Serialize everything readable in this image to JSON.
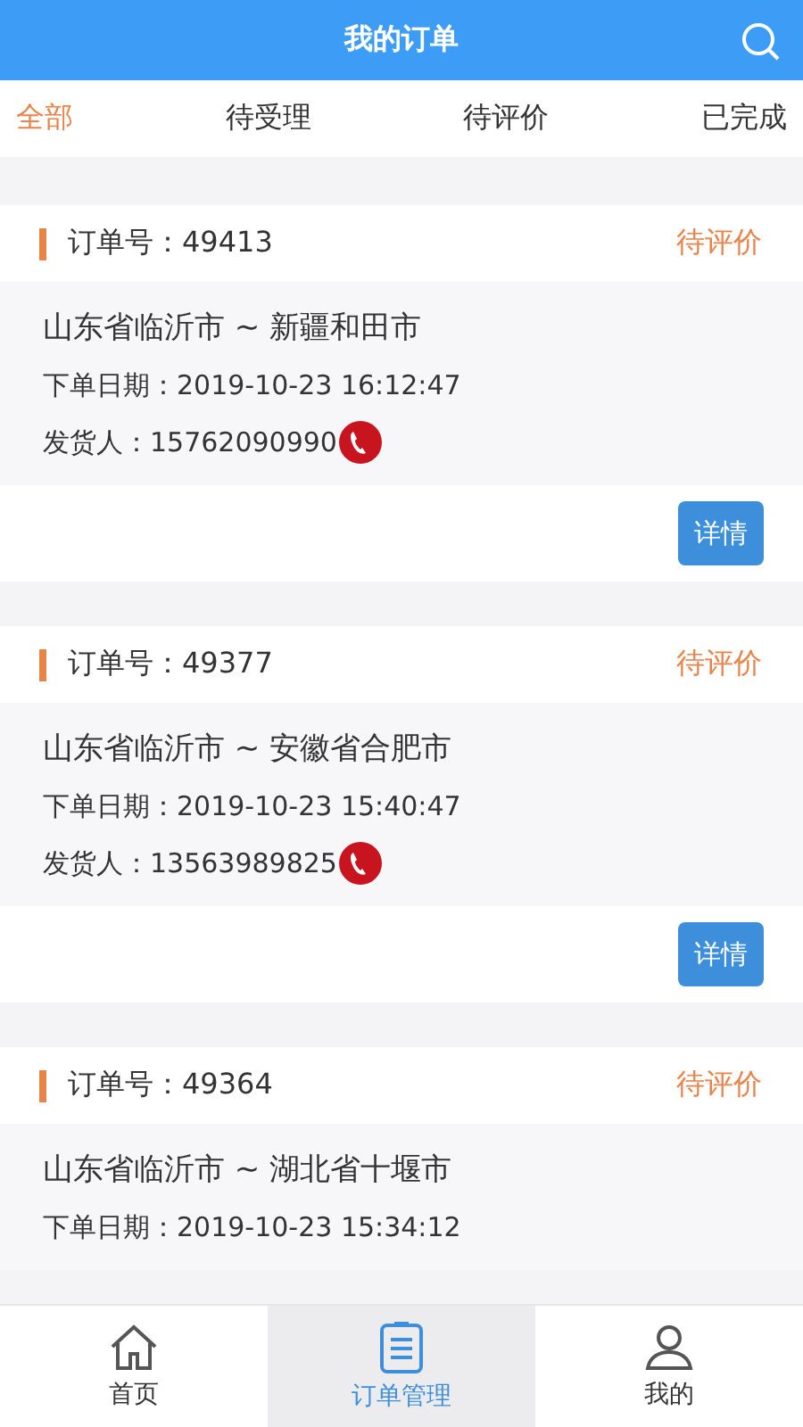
{
  "header": {
    "title": "我的订单"
  },
  "tabs": [
    {
      "label": "全部",
      "selected": true
    },
    {
      "label": "待受理",
      "selected": false
    },
    {
      "label": "待评价",
      "selected": false
    },
    {
      "label": "已完成",
      "selected": false
    }
  ],
  "orders": [
    {
      "number_label": "订单号：49413",
      "status": "待评价",
      "route": "山东省临沂市 ~ 新疆和田市",
      "date": "下单日期：2019-10-23 16:12:47",
      "shipper": "发货人：15762090990",
      "button": "详情"
    },
    {
      "number_label": "订单号：49377",
      "status": "待评价",
      "route": "山东省临沂市 ~ 安徽省合肥市",
      "date": "下单日期：2019-10-23 15:40:47",
      "shipper": "发货人：13563989825",
      "button": "详情"
    },
    {
      "number_label": "订单号：49364",
      "status": "待评价",
      "route": "山东省临沂市 ~ 湖北省十堰市",
      "date": "下单日期：2019-10-23 15:34:12"
    }
  ],
  "nav": [
    {
      "label": "首页",
      "kind": "home",
      "selected": false
    },
    {
      "label": "订单管理",
      "kind": "orders",
      "selected": true
    },
    {
      "label": "我的",
      "kind": "profile",
      "selected": false
    }
  ]
}
